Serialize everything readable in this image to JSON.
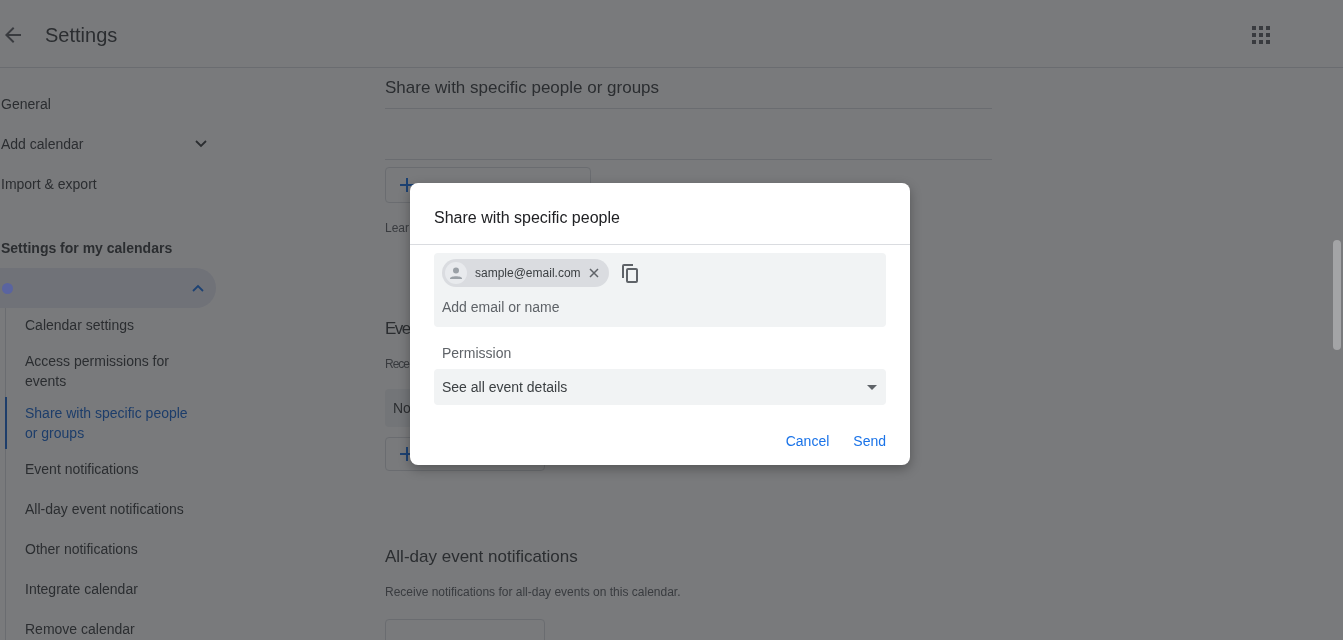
{
  "header": {
    "title": "Settings"
  },
  "sidebar": {
    "items": [
      {
        "label": "General",
        "kind": "link"
      },
      {
        "label": "Add calendar",
        "kind": "dropdown"
      },
      {
        "label": "Import & export",
        "kind": "link"
      }
    ],
    "section_title": "Settings for my calendars",
    "calendar": {
      "color": "#5a64a0",
      "expanded": true
    },
    "subitems": [
      {
        "label": "Calendar settings",
        "selected": false
      },
      {
        "label": "Access permissions for events",
        "selected": false
      },
      {
        "label": "Share with specific people or groups",
        "selected": true
      },
      {
        "label": "Event notifications",
        "selected": false
      },
      {
        "label": "All-day event notifications",
        "selected": false
      },
      {
        "label": "Other notifications",
        "selected": false
      },
      {
        "label": "Integrate calendar",
        "selected": false
      },
      {
        "label": "Remove calendar",
        "selected": false
      }
    ]
  },
  "content": {
    "share_heading": "Share with specific people or groups",
    "learn_text": "Lear",
    "events_heading": "Eve",
    "events_text": "Rece",
    "notification_select": "No",
    "allday_heading": "All-day event notifications",
    "allday_text": "Receive notifications for all-day events on this calendar."
  },
  "dialog": {
    "title": "Share with specific people",
    "chips": [
      {
        "email": "sample@email.com"
      }
    ],
    "placeholder": "Add email or name",
    "permission_label": "Permission",
    "permission_value": "See all event details",
    "buttons": [
      "Cancel",
      "Send"
    ]
  }
}
